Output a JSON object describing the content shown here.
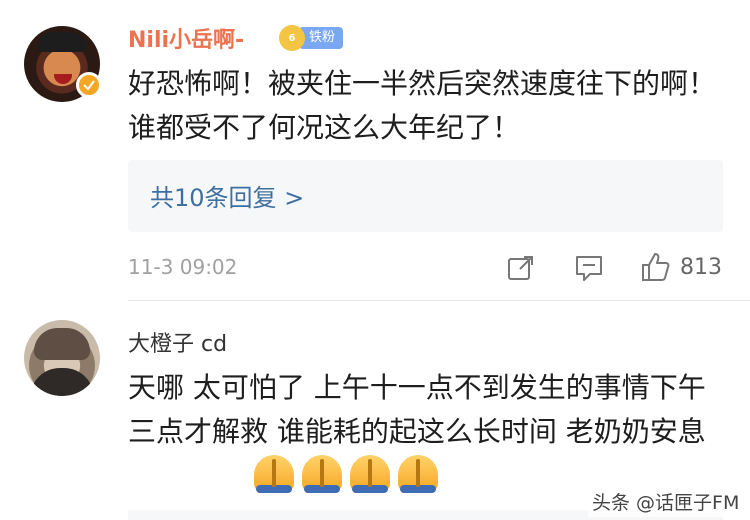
{
  "comments": [
    {
      "username": "Nili小岳啊-",
      "fan_badge": {
        "level": "6",
        "label": "铁粉"
      },
      "text": "好恐怖啊！被夹住一半然后突然速度往下的啊！谁都受不了何况这么大年纪了！",
      "replies_label": "共10条回复 >",
      "timestamp": "11-3 09:02",
      "likes": "813"
    },
    {
      "username": "大橙子 cd",
      "text": "天哪  太可怕了  上午十一点不到发生的事情下午三点才解救  谁能耗的起这么长时间  老奶奶安息"
    }
  ],
  "watermark": "头条 @话匣子FM",
  "icons": {
    "share": "share-icon",
    "comment": "comment-icon",
    "like": "thumbs-up-icon",
    "verified": "verified-badge-icon",
    "emoji": "praying-hands-emoji"
  },
  "colors": {
    "username_highlight": "#eb7350",
    "link": "#3e6fa0",
    "fan_badge": "#7aa7f2",
    "timestamp": "#a0a0a0"
  }
}
